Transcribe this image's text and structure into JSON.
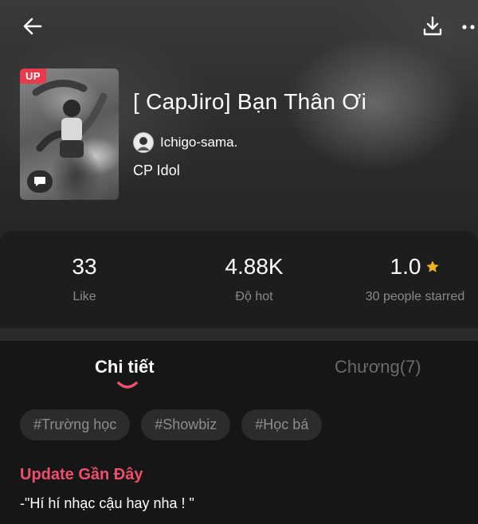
{
  "book": {
    "badge": "UP",
    "title": "[ CapJiro] Bạn Thân Ơi",
    "author": "Ichigo-sama.",
    "category": "CP Idol"
  },
  "stats": [
    {
      "value": "33",
      "label": "Like"
    },
    {
      "value": "4.88K",
      "label": "Độ hot"
    },
    {
      "value": "1.0",
      "label": "30 people starred"
    }
  ],
  "tabs": [
    {
      "label": "Chi tiết",
      "active": true
    },
    {
      "label": "Chương(7)",
      "active": false
    }
  ],
  "tags": [
    "#Trường học",
    "#Showbiz",
    "#Học bá"
  ],
  "update": {
    "heading": "Update Gần Đây",
    "text": "-\"Hí hí nhạc cậu hay nha ! \""
  },
  "colors": {
    "accent": "#ef4f6b",
    "badge": "#e8394d",
    "star": "#f5b31a"
  },
  "icons": {
    "back": "arrow-left-icon",
    "download": "download-icon",
    "more": "more-dots-icon",
    "chat": "chat-bubble-icon",
    "star": "star-icon"
  }
}
